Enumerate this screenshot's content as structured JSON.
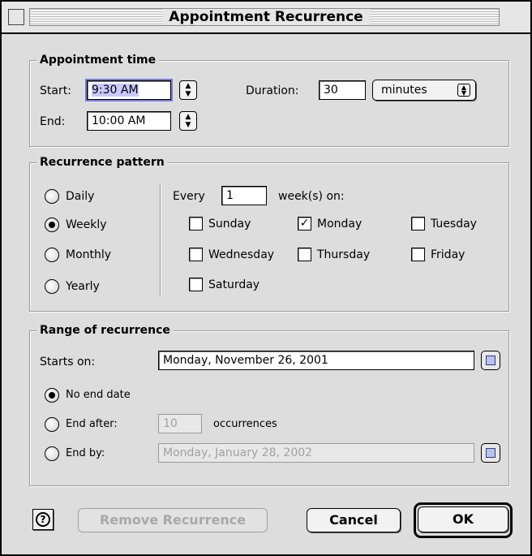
{
  "window": {
    "title": "Appointment Recurrence"
  },
  "appointment_time": {
    "title": "Appointment time",
    "start_label": "Start:",
    "start_value": "9:30 AM",
    "end_label": "End:",
    "end_value": "10:00 AM",
    "duration_label": "Duration:",
    "duration_value": "30",
    "duration_unit": "minutes"
  },
  "recurrence_pattern": {
    "title": "Recurrence pattern",
    "options": [
      "Daily",
      "Weekly",
      "Monthly",
      "Yearly"
    ],
    "selected": "Weekly",
    "every_label": "Every",
    "every_value": "1",
    "weeks_on_label": "week(s) on:",
    "days": [
      "Sunday",
      "Monday",
      "Tuesday",
      "Wednesday",
      "Thursday",
      "Friday",
      "Saturday"
    ],
    "checked_days": [
      "Monday"
    ]
  },
  "range": {
    "title": "Range of recurrence",
    "starts_on_label": "Starts on:",
    "starts_on_value": "Monday, November 26, 2001",
    "no_end_label": "No end date",
    "end_after_label": "End after:",
    "end_after_value": "10",
    "occurrences_label": "occurrences",
    "end_by_label": "End by:",
    "end_by_value": "Monday, January 28, 2002",
    "selected": "No end date"
  },
  "buttons": {
    "help_icon": "question-icon",
    "remove": "Remove Recurrence",
    "cancel": "Cancel",
    "ok": "OK"
  },
  "colors": {
    "selection": "#c9c9ff",
    "focus_ring": "#7a7ad8",
    "calendar_icon": "#b6c4ee"
  }
}
